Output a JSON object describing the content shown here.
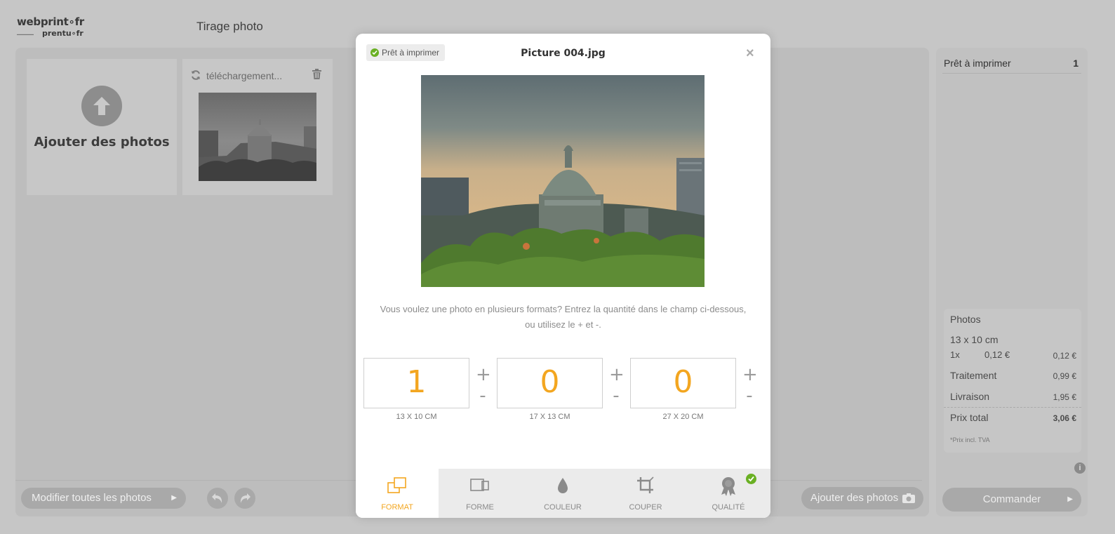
{
  "header": {
    "logo_line1": "webprint∘fr",
    "logo_line2": "prentu∘fr",
    "app_title": "Tirage photo"
  },
  "gallery": {
    "add_label": "Ajouter des photos",
    "upload_status": "téléchargement..."
  },
  "footer": {
    "modify_all_label": "Modifier toutes les photos",
    "add_photos_label": "Ajouter des photos"
  },
  "sidebar": {
    "ready_label": "Prêt à imprimer",
    "ready_count": "1",
    "summary": {
      "photos_label": "Photos",
      "format": "13 x 10 cm",
      "qty": "1x",
      "unit_price": "0,12 €",
      "line_total": "0,12 €",
      "treatment_label": "Traitement",
      "treatment_price": "0,99 €",
      "delivery_label": "Livraison",
      "delivery_price": "1,95 €",
      "total_label": "Prix total",
      "total_price": "3,06 €",
      "vat_note": "*Prix incl. TVA"
    },
    "info_icon": "i",
    "order_label": "Commander"
  },
  "modal": {
    "badge": "Prêt à imprimer",
    "title": "Picture 004.jpg",
    "close_icon": "×",
    "hint": "Vous voulez une photo en plusieurs formats? Entrez la quantité dans le champ ci-dessous, ou utilisez le + et -.",
    "formats": [
      {
        "qty": "1",
        "label": "13 X 10 CM"
      },
      {
        "qty": "0",
        "label": "17 X 13 CM"
      },
      {
        "qty": "0",
        "label": "27 X 20 CM"
      }
    ],
    "plus": "+",
    "minus": "-",
    "tabs": [
      {
        "label": "FORMAT",
        "icon": "format-icon",
        "active": true
      },
      {
        "label": "FORME",
        "icon": "shape-icon",
        "active": false
      },
      {
        "label": "COULEUR",
        "icon": "color-drop-icon",
        "active": false
      },
      {
        "label": "COUPER",
        "icon": "crop-icon",
        "active": false
      },
      {
        "label": "QUALITÉ",
        "icon": "quality-badge-icon",
        "active": false
      }
    ]
  },
  "colors": {
    "accent": "#f3a620",
    "ok_green": "#6ab023",
    "overlay_gray": "#c6c6c6"
  }
}
